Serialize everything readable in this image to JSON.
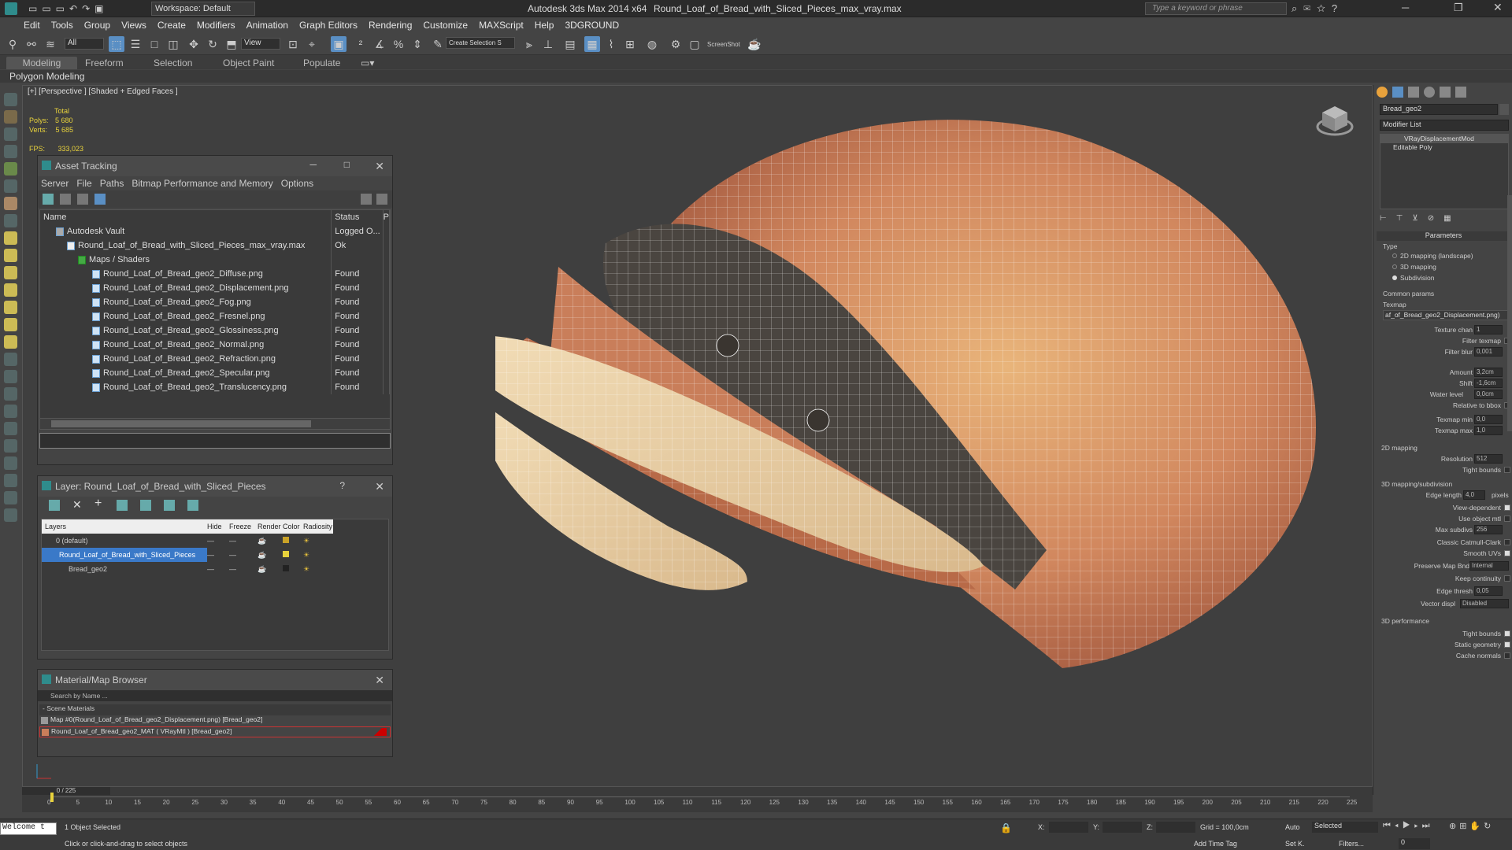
{
  "titlebar": {
    "app_title": "Autodesk 3ds Max  2014 x64",
    "file_title": "Round_Loaf_of_Bread_with_Sliced_Pieces_max_vray.max",
    "workspace": "Workspace: Default",
    "search_placeholder": "Type a keyword or phrase"
  },
  "menu": [
    "Edit",
    "Tools",
    "Group",
    "Views",
    "Create",
    "Modifiers",
    "Animation",
    "Graph Editors",
    "Rendering",
    "Customize",
    "MAXScript",
    "Help",
    "3DGROUND"
  ],
  "toolbar": {
    "filter_all": "All",
    "view_mode": "View",
    "selection_set": "Create Selection S",
    "screenshot": "ScreenShot"
  },
  "ribbon": {
    "tabs": [
      "Modeling",
      "Freeform",
      "Selection",
      "Object Paint",
      "Populate"
    ],
    "subtab": "Polygon Modeling"
  },
  "viewport": {
    "label": "[+] [Perspective ] [Shaded + Edged Faces ]",
    "stats_total": "Total",
    "polys_label": "Polys:",
    "polys_value": "5 680",
    "verts_label": "Verts:",
    "verts_value": "5 685",
    "fps_label": "FPS:",
    "fps_value": "333,023"
  },
  "asset_tracking": {
    "title": "Asset Tracking",
    "menu": [
      "Server",
      "File",
      "Paths",
      "Bitmap Performance and Memory",
      "Options"
    ],
    "col_name": "Name",
    "col_status": "Status",
    "col_extra": "P",
    "rows": [
      {
        "name": "Autodesk Vault",
        "status": "Logged O..."
      },
      {
        "name": "Round_Loaf_of_Bread_with_Sliced_Pieces_max_vray.max",
        "status": "Ok"
      },
      {
        "name": "Maps / Shaders",
        "status": ""
      },
      {
        "name": "Round_Loaf_of_Bread_geo2_Diffuse.png",
        "status": "Found"
      },
      {
        "name": "Round_Loaf_of_Bread_geo2_Displacement.png",
        "status": "Found"
      },
      {
        "name": "Round_Loaf_of_Bread_geo2_Fog.png",
        "status": "Found"
      },
      {
        "name": "Round_Loaf_of_Bread_geo2_Fresnel.png",
        "status": "Found"
      },
      {
        "name": "Round_Loaf_of_Bread_geo2_Glossiness.png",
        "status": "Found"
      },
      {
        "name": "Round_Loaf_of_Bread_geo2_Normal.png",
        "status": "Found"
      },
      {
        "name": "Round_Loaf_of_Bread_geo2_Refraction.png",
        "status": "Found"
      },
      {
        "name": "Round_Loaf_of_Bread_geo2_Specular.png",
        "status": "Found"
      },
      {
        "name": "Round_Loaf_of_Bread_geo2_Translucency.png",
        "status": "Found"
      }
    ]
  },
  "layer": {
    "title": "Layer: Round_Loaf_of_Bread_with_Sliced_Pieces",
    "help": "?",
    "cols": [
      "Layers",
      "Hide",
      "Freeze",
      "Render",
      "Color",
      "Radiosity"
    ],
    "rows": [
      {
        "name": "0 (default)"
      },
      {
        "name": "Round_Loaf_of_Bread_with_Sliced_Pieces"
      },
      {
        "name": "Bread_geo2"
      }
    ]
  },
  "material_browser": {
    "title": "Material/Map Browser",
    "search_placeholder": "Search by Name ...",
    "group": "- Scene Materials",
    "items": [
      "Map #0(Round_Loaf_of_Bread_geo2_Displacement.png) [Bread_geo2]",
      "Round_Loaf_of_Bread_geo2_MAT ( VRayMtl ) [Bread_geo2]"
    ]
  },
  "command_panel": {
    "object_name": "Bread_geo2",
    "modifier_list": "Modifier List",
    "stack": [
      "VRayDisplacementMod",
      "Editable Poly"
    ],
    "parameters": "Parameters",
    "type_label": "Type",
    "type_options": [
      "2D mapping (landscape)",
      "3D mapping",
      "Subdivision"
    ],
    "common_params": "Common params",
    "texmap_label": "Texmap",
    "texmap_value": "af_of_Bread_geo2_Displacement.png)",
    "fields": [
      {
        "label": "Texture chan",
        "value": "1"
      },
      {
        "label": "Filter texmap",
        "value": ""
      },
      {
        "label": "Filter blur",
        "value": "0,001"
      },
      {
        "label": "Amount",
        "value": "3,2cm"
      },
      {
        "label": "Shift",
        "value": "-1,6cm"
      },
      {
        "label": "Water level",
        "value": "0,0cm"
      },
      {
        "label": "Relative to bbox",
        "value": ""
      },
      {
        "label": "Texmap min",
        "value": "0,0"
      },
      {
        "label": "Texmap max",
        "value": "1,0"
      }
    ],
    "mapping2d": "2D mapping",
    "resolution_label": "Resolution",
    "resolution_value": "512",
    "tight_bounds": "Tight bounds",
    "mapping3d": "3D mapping/subdivision",
    "edge_length_label": "Edge length",
    "edge_length_value": "4,0",
    "pixels": "pixels",
    "view_dependent": "View-dependent",
    "use_object_mtl": "Use object mtl",
    "max_subdivs_label": "Max subdivs",
    "max_subdivs_value": "256",
    "classic_cc": "Classic Catmull-Clark",
    "smooth_uvs": "Smooth UVs",
    "preserve_map_bnd": "Preserve Map Bnd",
    "preserve_value": "Internal",
    "keep_continuity": "Keep continuity",
    "edge_thresh_label": "Edge thresh",
    "edge_thresh_value": "0,05",
    "vector_displ_label": "Vector displ",
    "vector_displ_value": "Disabled",
    "perf": "3D performance",
    "perf_tight": "Tight bounds",
    "static_geom": "Static geometry",
    "cache_normals": "Cache normals"
  },
  "timeline": {
    "frame": "0 / 225",
    "ticks": [
      "0",
      "5",
      "10",
      "15",
      "20",
      "25",
      "30",
      "35",
      "40",
      "45",
      "50",
      "55",
      "60",
      "65",
      "70",
      "75",
      "80",
      "85",
      "90",
      "95",
      "100",
      "105",
      "110",
      "115",
      "120",
      "125",
      "130",
      "135",
      "140",
      "145",
      "150",
      "155",
      "160",
      "165",
      "170",
      "175",
      "180",
      "185",
      "190",
      "195",
      "200",
      "205",
      "210",
      "215",
      "220",
      "225"
    ]
  },
  "status": {
    "welcome": "Welcome t",
    "selected": "1 Object Selected",
    "hint": "Click or click-and-drag to select objects",
    "x": "X:",
    "y": "Y:",
    "z": "Z:",
    "grid": "Grid = 100,0cm",
    "add_time_tag": "Add Time Tag",
    "auto": "Auto",
    "setk": "Set K.",
    "sel_mode": "Selected",
    "filters": "Filters...",
    "frame_value": "0"
  }
}
